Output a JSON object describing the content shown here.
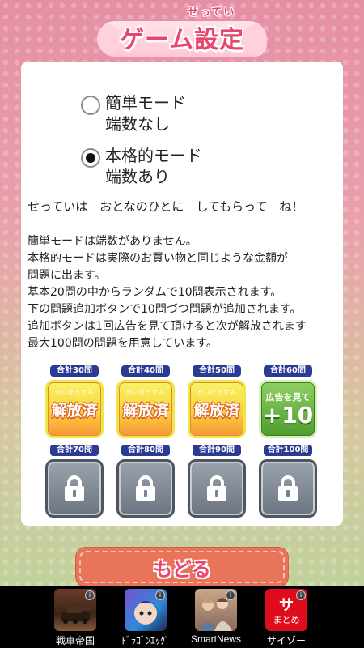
{
  "title": {
    "text": "ゲーム設定",
    "ruby": "せってい"
  },
  "modes": [
    {
      "line1": "簡単モード",
      "line2": "端数なし",
      "selected": false
    },
    {
      "line1": "本格的モード",
      "line2": "端数あり",
      "selected": true
    }
  ],
  "notice": "せっていは　おとなのひとに　してもらって　ね！",
  "description": [
    "簡単モードは端数がありません。",
    "本格的モードは実際のお買い物と同じような金額が",
    "問題に出ます。",
    "基本20問の中からランダムで10問表示されます。",
    "下の問題追加ボタンで10問づつ問題が追加されます。",
    "追加ボタンは1回広告を見て頂けると次が解放されます",
    "最大100問の問題を用意しています。"
  ],
  "tiles": [
    {
      "label": "合計30問",
      "state": "open",
      "ruby": "かいほうずみ",
      "text": "解放済"
    },
    {
      "label": "合計40問",
      "state": "open",
      "ruby": "かいほうずみ",
      "text": "解放済"
    },
    {
      "label": "合計50問",
      "state": "open",
      "ruby": "かいほうずみ",
      "text": "解放済"
    },
    {
      "label": "合計60問",
      "state": "ad",
      "top": "広告を見て",
      "big": "+10"
    },
    {
      "label": "合計70問",
      "state": "locked",
      "icon": "lock-icon"
    },
    {
      "label": "合計80問",
      "state": "locked",
      "icon": "lock-icon"
    },
    {
      "label": "合計90問",
      "state": "locked",
      "icon": "lock-icon"
    },
    {
      "label": "合計100問",
      "state": "locked",
      "icon": "lock-icon"
    }
  ],
  "back_button": "もどる",
  "ad_bar": {
    "apps": [
      {
        "name": "戦車帝国",
        "icon": "tank-game-icon"
      },
      {
        "name": "ﾄﾞﾗｺﾞﾝｴｯｸﾞ",
        "icon": "dragon-egg-icon"
      },
      {
        "name": "SmartNews",
        "icon": "smartnews-icon"
      },
      {
        "name": "サイゾー",
        "icon": "saizo-icon",
        "icon_top": "サ",
        "icon_bottom": "まとめ"
      }
    ],
    "badge": "i"
  },
  "colors": {
    "title": "#e8476d",
    "tile_label": "#2a3b94",
    "back_button": "#e8755a",
    "ad_tile": "#4f9d30"
  }
}
